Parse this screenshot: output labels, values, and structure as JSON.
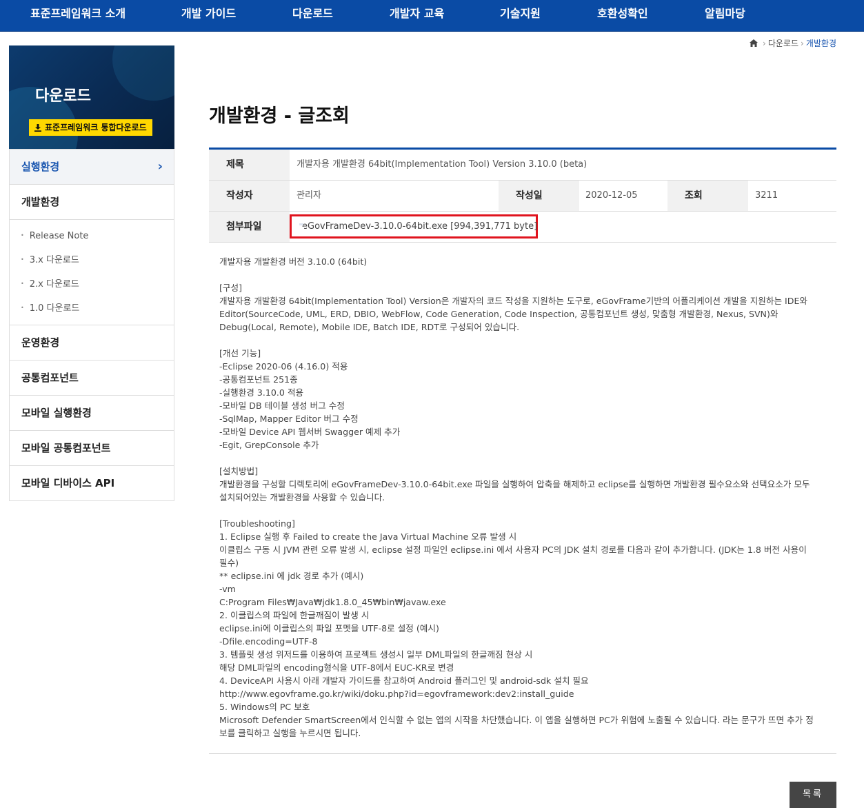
{
  "topnav": {
    "items": [
      "표준프레임워크 소개",
      "개발 가이드",
      "다운로드",
      "개발자 교육",
      "기술지원",
      "호환성확인",
      "알림마당"
    ]
  },
  "sidebar": {
    "banner_title": "다운로드",
    "download_button": "표준프레임워크 통합다운로드",
    "menu": [
      {
        "label": "실행환경",
        "active": true
      },
      {
        "label": "개발환경"
      },
      {
        "label": "운영환경"
      },
      {
        "label": "공통컴포넌트"
      },
      {
        "label": "모바일 실행환경"
      },
      {
        "label": "모바일 공통컴포넌트"
      },
      {
        "label": "모바일 디바이스 API"
      }
    ],
    "submenu": [
      "Release Note",
      "3.x 다운로드",
      "2.x 다운로드",
      "1.0 다운로드"
    ]
  },
  "breadcrumb": {
    "items": [
      "다운로드",
      "개발환경"
    ]
  },
  "page_title": "개발환경 - 글조회",
  "post": {
    "title_label": "제목",
    "title": "개발자용 개발환경 64bit(Implementation Tool) Version 3.10.0 (beta)",
    "author_label": "작성자",
    "author": "관리자",
    "date_label": "작성일",
    "date": "2020-12-05",
    "views_label": "조회",
    "views": "3211",
    "attach_label": "첨부파일",
    "attachment": "eGovFrameDev-3.10.0-64bit.exe [994,391,771 byte]",
    "body_lines": [
      "개발자용 개발환경 버전 3.10.0 (64bit)",
      "",
      "[구성]",
      "개발자용 개발환경 64bit(Implementation Tool) Version은 개발자의 코드 작성을 지원하는 도구로, eGovFrame기반의 어플리케이션 개발을 지원하는 IDE와",
      "Editor(SourceCode, UML, ERD, DBIO, WebFlow, Code Generation, Code Inspection, 공통컴포넌트 생성, 맞춤형 개발환경, Nexus, SVN)와",
      "Debug(Local, Remote), Mobile IDE, Batch IDE, RDT로 구성되어 있습니다.",
      "",
      "[개선 기능]",
      "-Eclipse 2020-06 (4.16.0) 적용",
      "-공통컴포넌트 251종",
      "-실행환경 3.10.0 적용",
      "-모바일 DB 테이블 생성 버그 수정",
      "-SqlMap, Mapper Editor 버그 수정",
      "-모바일 Device API 웹서버 Swagger 예제 추가",
      "-Egit, GrepConsole 추가",
      "",
      "[설치방법]",
      "개발환경을 구성할 디렉토리에 eGovFrameDev-3.10.0-64bit.exe 파일을 실행하여 압축을 해제하고 eclipse를 실행하면 개발환경 필수요소와 선택요소가 모두",
      "설치되어있는 개발환경을 사용할 수 있습니다.",
      "",
      "[Troubleshooting]",
      "1. Eclipse 실행 후 Failed to create the Java Virtual Machine 오류 발생 시",
      "이클립스 구동 시 JVM 관련 오류 발생 시, eclipse 설정 파일인 eclipse.ini 에서 사용자 PC의 JDK 설치 경로를 다음과 같이 추가합니다. (JDK는 1.8 버전 사용이",
      "필수)",
      "** eclipse.ini 에 jdk 경로 추가 (예시)",
      "-vm",
      "C:Program Files₩Java₩jdk1.8.0_45₩bin₩javaw.exe",
      "2. 이클립스의 파일에 한글깨짐이 발생 시",
      "eclipse.ini에 이클립스의 파일 포멧을 UTF-8로 설정 (예시)",
      "-Dfile.encoding=UTF-8",
      "3. 템플릿 생성 위저드를 이용하여 프로젝트 생성시 일부 DML파일의 한글깨짐 현상 시",
      "해당 DML파일의 encoding형식을 UTF-8에서 EUC-KR로 변경",
      "4. DeviceAPI 사용시 아래 개발자 가이드를 참고하여 Android 플러그인 및 android-sdk 설치 필요",
      "http://www.egovframe.go.kr/wiki/doku.php?id=egovframework:dev2:install_guide",
      "5. Windows의 PC 보호",
      "Microsoft Defender SmartScreen에서 인식할 수 없는 앱의 시작을 차단했습니다. 이 앱을 실행하면 PC가 위험에 노출될 수 있습니다. 라는 문구가 뜨면 추가 정",
      "보를 클릭하고 실행을 누르시면 됩니다."
    ]
  },
  "list_button": "목록",
  "colors": {
    "nav_bg": "#0a4ba5",
    "accent": "#1a56b0",
    "download_button_bg": "#ffd800",
    "highlight_border": "#e0141e",
    "list_button_bg": "#454545"
  }
}
